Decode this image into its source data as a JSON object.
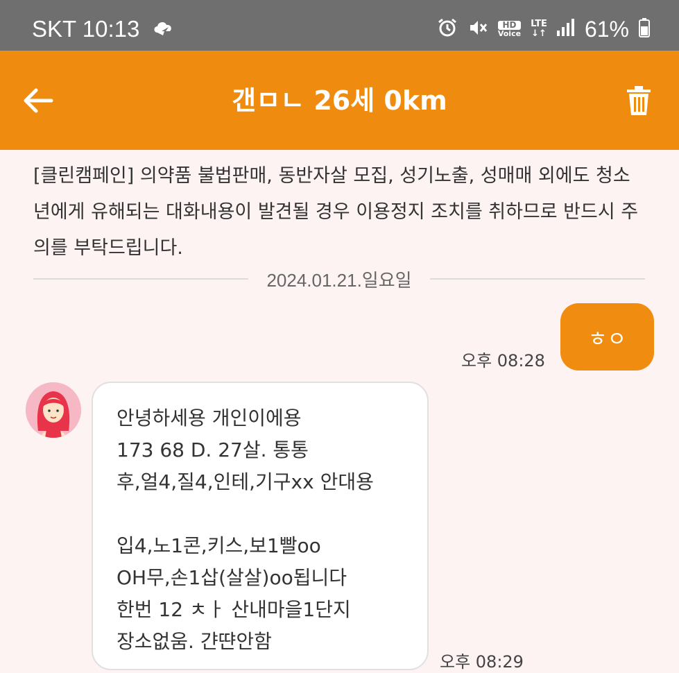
{
  "status_bar": {
    "carrier_time": "SKT 10:13",
    "hd_label": "HD",
    "voice_label": "Voice",
    "lte_label": "LTE",
    "battery": "61%"
  },
  "app_bar": {
    "title": "갠ㅁㄴ 26세 0km"
  },
  "notice": {
    "text": "[클린캠페인] 의약품 불법판매, 동반자살 모집, 성기노출, 성매매 외에도 청소년에게 유해되는 대화내용이 발견될 경우 이용정지 조치를 취하므로 반드시 주의를 부탁드립니다."
  },
  "date_divider": {
    "date": "2024.01.21.일요일"
  },
  "messages": [
    {
      "direction": "outgoing",
      "text": "ㅎㅇ",
      "time": "오후 08:28"
    },
    {
      "direction": "incoming",
      "text": "안녕하세용 개인이에용\n173 68 D. 27살. 통통\n후,얼4,질4,인테,기구xx 안대용\n\n입4,노1콘,키스,보1빨oo\nOH무,손1삽(살살)oo됩니다\n한번 12 ㅊㅏ 산내마을1단지\n장소없움. 갼땬안함",
      "time": "오후 08:29"
    }
  ],
  "colors": {
    "accent": "#ef8c10",
    "status_bar": "#6f6f6f",
    "background": "#fdf3f3"
  },
  "icons": [
    "back-arrow-icon",
    "trash-icon",
    "alarm-icon",
    "mute-icon",
    "signal-icon",
    "battery-icon",
    "cloud-icon",
    "avatar"
  ]
}
